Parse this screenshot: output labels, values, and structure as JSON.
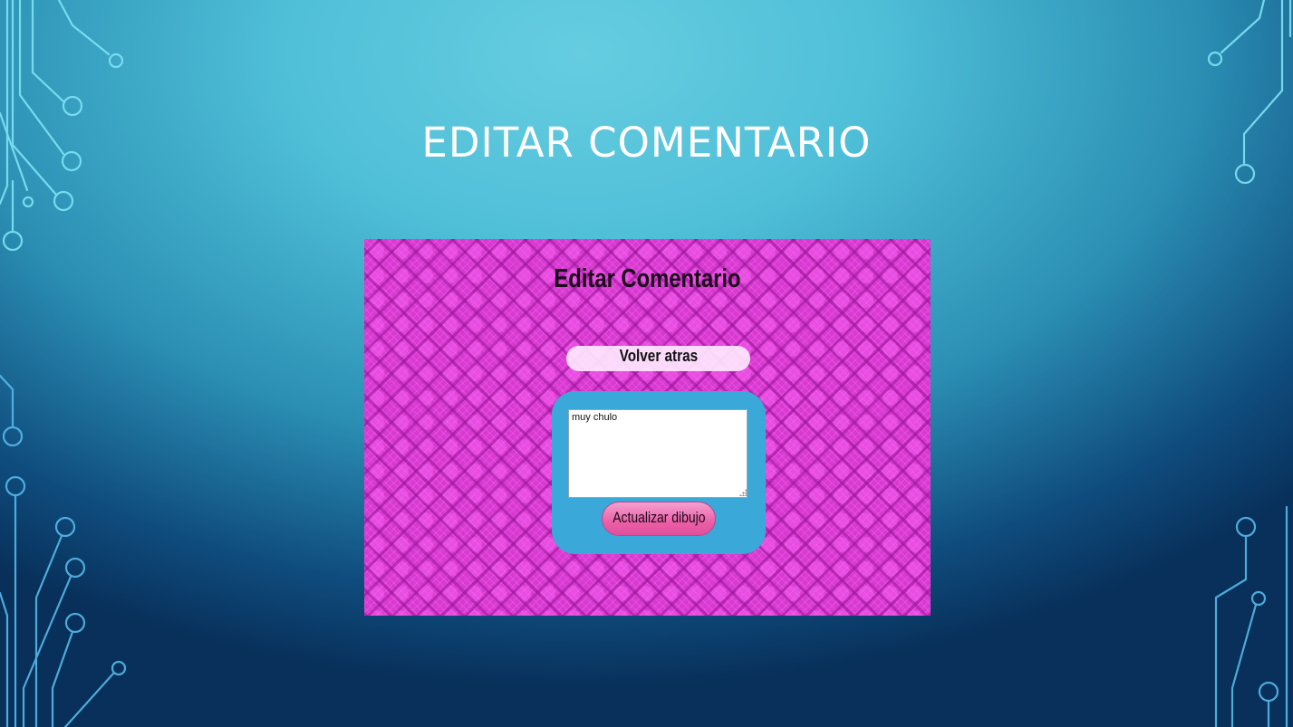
{
  "slide": {
    "title": "EDITAR COMENTARIO"
  },
  "screenshot": {
    "page_title": "Editar Comentario",
    "back_button_label": "Volver atras",
    "comment_value": "muy chulo",
    "submit_button_label": "Actualizar dibujo"
  },
  "colors": {
    "slide_background": "#4fbfd8",
    "page_background": "#d73ad0",
    "form_panel": "#3aa8d8",
    "submit_button": "#ec5fa7",
    "back_button": "#ffebff"
  },
  "icons": {
    "decoration": "circuit-lines-icon",
    "textarea_corner": "resize-grip-icon"
  }
}
